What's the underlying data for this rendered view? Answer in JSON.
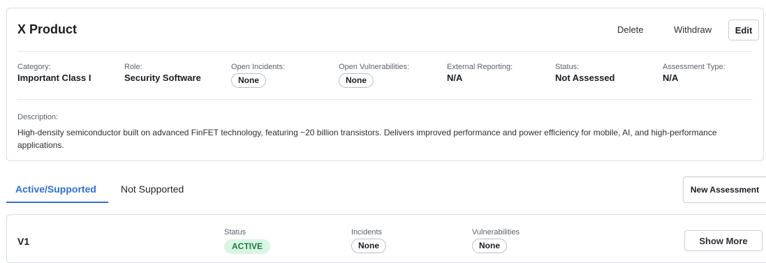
{
  "product": {
    "title": "X Product",
    "actions": {
      "delete_label": "Delete",
      "withdraw_label": "Withdraw",
      "edit_label": "Edit"
    },
    "fields": {
      "category": {
        "label": "Category:",
        "value": "Important Class I"
      },
      "role": {
        "label": "Role:",
        "value": "Security Software"
      },
      "open_incidents": {
        "label": "Open Incidents:",
        "value": "None"
      },
      "open_vulnerabilities": {
        "label": "Open Vulnerabilities:",
        "value": "None"
      },
      "external_reporting": {
        "label": "External Reporting:",
        "value": "N/A"
      },
      "status": {
        "label": "Status:",
        "value": "Not Assessed"
      },
      "assessment_type": {
        "label": "Assessment Type:",
        "value": "N/A"
      }
    },
    "description": {
      "label": "Description:",
      "text": "High-density semiconductor built on advanced FinFET technology, featuring ~20 billion transistors. Delivers improved performance and power efficiency for mobile, AI, and high-performance applications."
    }
  },
  "tabs": {
    "items": [
      {
        "label": "Active/Supported",
        "active": true
      },
      {
        "label": "Not Supported",
        "active": false
      }
    ],
    "new_assessment_label": "New Assessment"
  },
  "versions": [
    {
      "name": "V1",
      "status_label": "Status",
      "status_value": "ACTIVE",
      "incidents_label": "Incidents",
      "incidents_value": "None",
      "vulnerabilities_label": "Vulnerabilities",
      "vulnerabilities_value": "None",
      "show_more_label": "Show More"
    }
  ],
  "colors": {
    "accent": "#2f6fd6",
    "active_badge_bg": "#d9f5e3",
    "active_badge_text": "#1d7a44",
    "border": "#d7dbe0"
  }
}
